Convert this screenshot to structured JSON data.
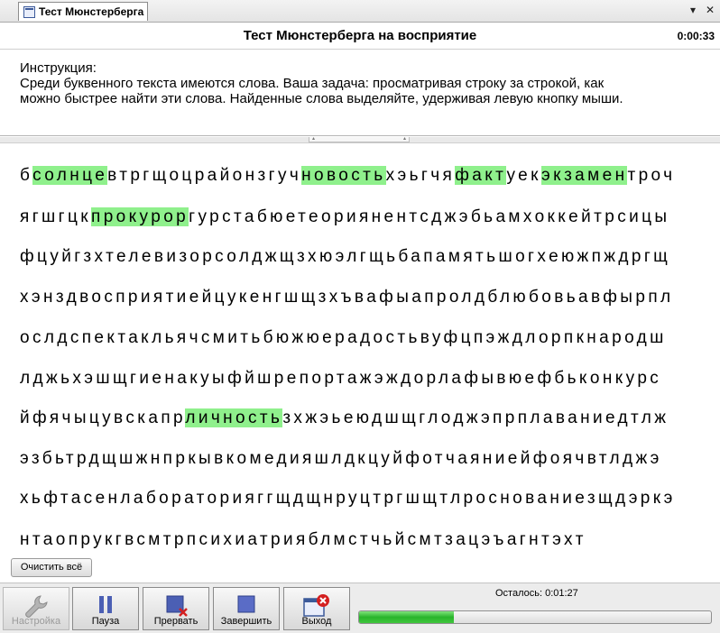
{
  "tab": {
    "title": "Тест Мюнстерберга"
  },
  "window": {
    "pin_glyph": "▾",
    "close_glyph": "✕"
  },
  "header": {
    "title": "Тест Мюнстерберга на восприятие",
    "timer": "0:00:33"
  },
  "instructions": {
    "heading": "Инструкция:",
    "line1": "Среди буквенного текста имеются слова. Ваша задача: просматривая строку за строкой, как",
    "line2": "можно быстрее найти эти слова. Найденные слова выделяйте, удерживая левую кнопку мыши."
  },
  "splitter": {
    "left_glyph": "▴",
    "right_glyph": "▴"
  },
  "rows": [
    [
      {
        "t": "б",
        "h": false
      },
      {
        "t": "солнце",
        "h": true
      },
      {
        "t": "втргщоцрайонзгуч",
        "h": false
      },
      {
        "t": "новость",
        "h": true
      },
      {
        "t": "хэьгчя",
        "h": false
      },
      {
        "t": "факт",
        "h": true
      },
      {
        "t": "уек",
        "h": false
      },
      {
        "t": "экзамен",
        "h": true
      },
      {
        "t": "троч",
        "h": false
      }
    ],
    [
      {
        "t": "ягшгцк",
        "h": false
      },
      {
        "t": "прокурор",
        "h": true
      },
      {
        "t": "гурстабюетеориянентсджэбьамхоккейтрсицы",
        "h": false
      }
    ],
    [
      {
        "t": "фцуйгзхтелевизорсолджщзхюэлгщьбапамятьшогхеюжпждргщ",
        "h": false
      }
    ],
    [
      {
        "t": "хэнздвосприятиейцукенгшщзхъвафыапролдблюбовьавфырпл",
        "h": false
      }
    ],
    [
      {
        "t": "ослдспектакльячсмитьбюжюерадостьвуфцпэждлорпкнародш",
        "h": false
      }
    ],
    [
      {
        "t": "лджьхэшщгиенакуыфйшрепортажэждорлафывюефбьконкурс",
        "h": false
      }
    ],
    [
      {
        "t": "йфячыцувскапр",
        "h": false
      },
      {
        "t": "личность",
        "h": true
      },
      {
        "t": "зхжэьеюдшщглоджэпрплаваниедтлж",
        "h": false
      }
    ],
    [
      {
        "t": "эзбьтрдщшжнпркывкомедияшлдкцуйфотчаяниейфоячвтлджэ",
        "h": false
      }
    ],
    [
      {
        "t": "хьфтасенлабораторияггщдщнруцтргшщтлроснованиезщдэркэ",
        "h": false
      }
    ],
    [
      {
        "t": "нтаопрукгвсмтрпсихиатрияблмстчьйсмтзацэъагнтэхт",
        "h": false
      }
    ]
  ],
  "clear_button": {
    "label": "Очистить всё"
  },
  "toolbar": {
    "settings": {
      "label": "Настройка",
      "icon": "wrench-icon"
    },
    "pause": {
      "label": "Пауза",
      "icon": "pause-icon"
    },
    "abort": {
      "label": "Прервать",
      "icon": "abort-icon"
    },
    "finish": {
      "label": "Завершить",
      "icon": "stop-icon"
    },
    "exit": {
      "label": "Выход",
      "icon": "exit-icon"
    }
  },
  "status": {
    "remaining": "Осталось: 0:01:27",
    "progress": 0.27
  },
  "colors": {
    "highlight": "#8ff08c",
    "progress": "#28b42a",
    "icon_blue": "#4b5fb4",
    "icon_red": "#d42020"
  }
}
